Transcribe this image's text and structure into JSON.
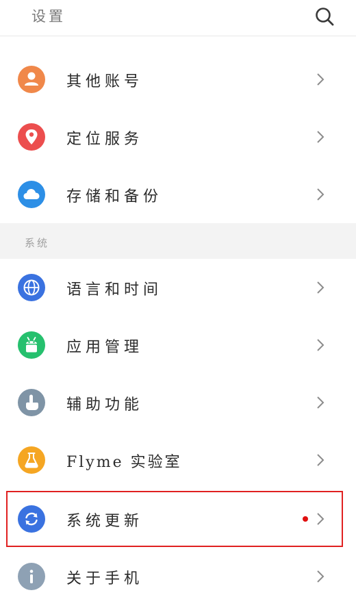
{
  "header": {
    "title": "设置"
  },
  "items_top": [
    {
      "label": "其他账号",
      "icon": "account-icon",
      "color": "#f0884a"
    },
    {
      "label": "定位服务",
      "icon": "location-pin-icon",
      "color": "#ec4e4e"
    },
    {
      "label": "存储和备份",
      "icon": "cloud-icon",
      "color": "#2d8fe6"
    }
  ],
  "section": {
    "label": "系统"
  },
  "items_system": [
    {
      "label": "语言和时间",
      "icon": "globe-icon",
      "color": "#3a72e0"
    },
    {
      "label": "应用管理",
      "icon": "android-icon",
      "color": "#26c06e"
    },
    {
      "label": "辅助功能",
      "icon": "hand-pointer-icon",
      "color": "#7f94a6"
    },
    {
      "label": "Flyme 实验室",
      "icon": "flask-icon",
      "color": "#f5a623"
    },
    {
      "label": "系统更新",
      "icon": "refresh-icon",
      "color": "#3a72e0",
      "has_badge": true
    },
    {
      "label": "关于手机",
      "icon": "info-icon",
      "color": "#8ea1b4"
    }
  ],
  "colors": {
    "highlight": "#e02020",
    "badge": "#e01010",
    "section_bg": "#f3f3f3"
  }
}
